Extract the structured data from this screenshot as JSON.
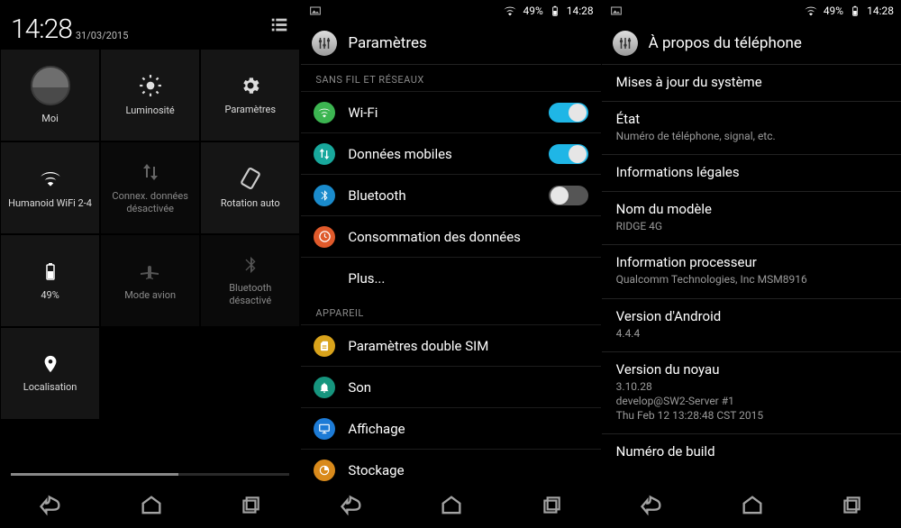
{
  "phone1": {
    "time": "14:28",
    "date": "31/03/2015",
    "tiles": {
      "me": {
        "label": "Moi"
      },
      "brightness": {
        "label": "Luminosité"
      },
      "settings": {
        "label": "Paramètres"
      },
      "wifi": {
        "label": "Humanoid WiFi 2-4"
      },
      "data": {
        "label": "Connex. données\ndésactivée"
      },
      "rotation": {
        "label": "Rotation auto"
      },
      "battery": {
        "label": "49%"
      },
      "airplane": {
        "label": "Mode avion"
      },
      "bluetooth": {
        "label": "Bluetooth\ndésactivé"
      },
      "location": {
        "label": "Localisation"
      }
    }
  },
  "status": {
    "battery_pct": "49%",
    "time": "14:28"
  },
  "phone2": {
    "title": "Paramètres",
    "section_wireless": "SANS FIL ET RÉSEAUX",
    "section_device": "APPAREIL",
    "rows": {
      "wifi": {
        "label": "Wi-Fi",
        "on": true
      },
      "mobile": {
        "label": "Données mobiles",
        "on": true
      },
      "bt": {
        "label": "Bluetooth",
        "on": false
      },
      "usage": {
        "label": "Consommation des données"
      },
      "more": {
        "label": "Plus..."
      },
      "dualsim": {
        "label": "Paramètres double SIM"
      },
      "sound": {
        "label": "Son"
      },
      "display": {
        "label": "Affichage"
      },
      "storage": {
        "label": "Stockage"
      }
    }
  },
  "phone3": {
    "title": "À propos du téléphone",
    "items": {
      "updates": {
        "title": "Mises à jour du système"
      },
      "status": {
        "title": "État",
        "sub": "Numéro de téléphone, signal, etc."
      },
      "legal": {
        "title": "Informations légales"
      },
      "model": {
        "title": "Nom du modèle",
        "sub": "RIDGE 4G"
      },
      "cpu": {
        "title": "Information processeur",
        "sub": "Qualcomm Technologies, Inc MSM8916"
      },
      "android": {
        "title": "Version d'Android",
        "sub": "4.4.4"
      },
      "kernel": {
        "title": "Version du noyau",
        "sub": "3.10.28\ndevelop@SW2-Server #1\nThu Feb 12 13:28:48 CST 2015"
      },
      "build": {
        "title": "Numéro de build"
      }
    }
  }
}
